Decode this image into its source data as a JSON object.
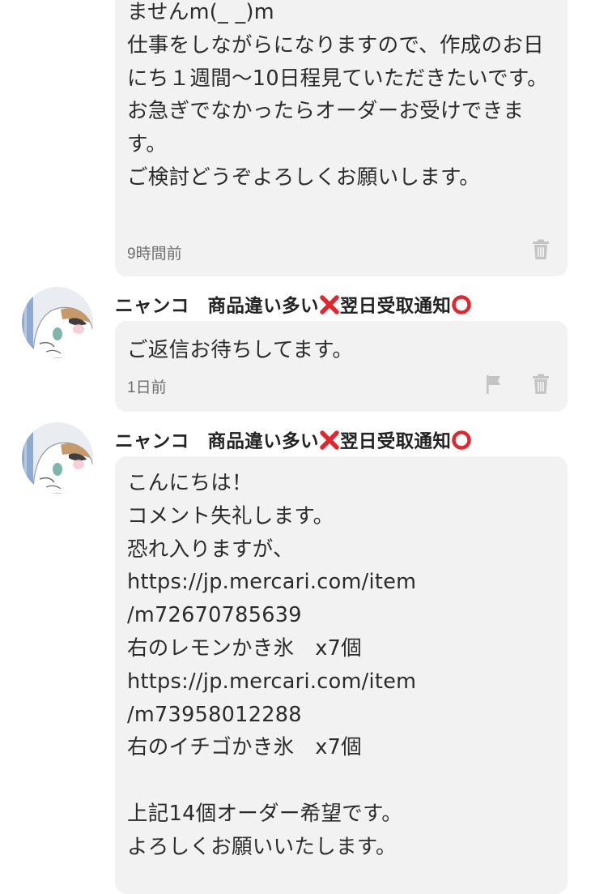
{
  "comments": [
    {
      "text": "ませんm(_ _)m\n仕事をしながらになりますので、作成のお日にち１週間〜10日程見ていただきたいです。\nお急ぎでなかったらオーダーお受けできます。\nご検討どうぞよろしくお願いします。",
      "time": "9時間前",
      "actions": [
        "trash-icon"
      ]
    },
    {
      "username": "ニャンコ　商品違い多い❌翌日受取通知⭕",
      "text": "ご返信お待ちしてます。",
      "time": "1日前",
      "actions": [
        "flag-icon",
        "trash-icon"
      ]
    },
    {
      "username": "ニャンコ　商品違い多い❌翌日受取通知⭕",
      "text": "こんにちは！\nコメント失礼します。\n恐れ入りますが、\nhttps://jp.mercari.com/item\n/m72670785639\n右のレモンかき氷　x7個\nhttps://jp.mercari.com/item\n/m73958012288\n右のイチゴかき氷　x7個\n\n上記14個オーダー希望です。\nよろしくお願いいたします。"
    }
  ],
  "colors": {
    "bubble_background": "#f2f2f2",
    "meta_text": "#6e6e6e",
    "cross_mark": "#e0262e",
    "circle_mark": "#e0262e",
    "icon_gray": "#c4c4c4"
  },
  "icons": {
    "delete": "trash-icon",
    "report": "flag-icon",
    "avatar": "cat-avatar"
  }
}
